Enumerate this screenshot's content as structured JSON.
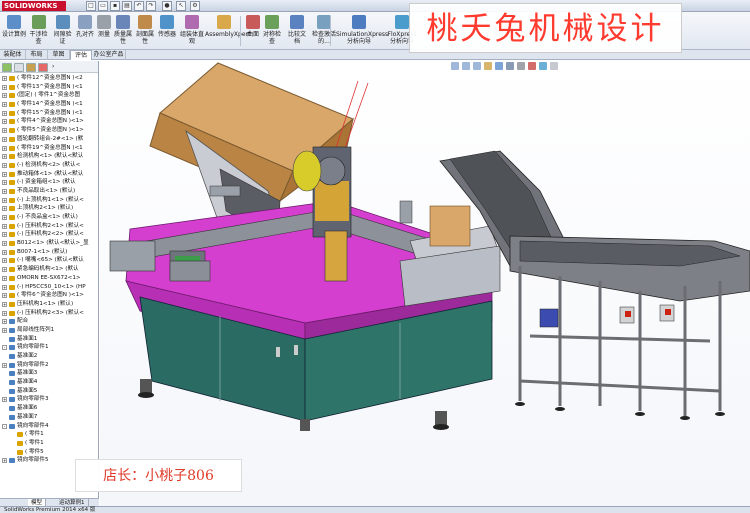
{
  "app": {
    "logo_text": "SOLIDWORKS",
    "status_text": "SolidWorks Premium 2014 x64 版"
  },
  "ribbon": [
    {
      "label": "设计算例",
      "icon": "design-study-icon"
    },
    {
      "label": "干涉检查",
      "icon": "interference-icon"
    },
    {
      "label": "间隙验证",
      "icon": "clearance-icon"
    },
    {
      "label": "孔对齐",
      "icon": "hole-align-icon"
    },
    {
      "label": "测量",
      "icon": "measure-icon"
    },
    {
      "label": "质量属性",
      "icon": "mass-properties-icon"
    },
    {
      "label": "剖面属性",
      "icon": "section-properties-icon"
    },
    {
      "label": "传感器",
      "icon": "sensor-icon"
    },
    {
      "label": "组装体直观",
      "icon": "assembly-visualization-icon"
    },
    {
      "label": "AssemblyXpert",
      "icon": "assemblyxpert-icon"
    },
    {
      "label": "曲面",
      "icon": "surface-icon"
    },
    {
      "label": "对称检查",
      "icon": "symmetry-check-icon"
    },
    {
      "label": "比较文档",
      "icon": "compare-icon"
    },
    {
      "label": "检查激活的...",
      "icon": "check-icon"
    },
    {
      "label": "SimulationXpress 分析向导",
      "icon": "simulationxpress-icon"
    },
    {
      "label": "FloXpress 分析向导",
      "icon": "floxpress-icon"
    }
  ],
  "command_tabs": [
    "装配体",
    "布局",
    "草图",
    "评估",
    "办公室产品"
  ],
  "tree": [
    {
      "label": "( 零件12^资金总图N )<2",
      "exp": "+",
      "color": "#d9a400"
    },
    {
      "label": "( 零件13^资金总图N )<1",
      "exp": "+",
      "color": "#d9a400"
    },
    {
      "label": "(固定) ( 零件1^资金总图",
      "exp": "+",
      "color": "#d9a400"
    },
    {
      "label": "( 零件14^资金总图N )<1",
      "exp": "+",
      "color": "#d9a400"
    },
    {
      "label": "( 零件15^资金总图N )<1",
      "exp": "+",
      "color": "#d9a400"
    },
    {
      "label": "( 零件4^资金总图N )<1>",
      "exp": "+",
      "color": "#d9a400"
    },
    {
      "label": "( 零件5^资金总图N )<1>",
      "exp": "+",
      "color": "#d9a400"
    },
    {
      "label": "圆轮翻转组合-2#<1> (默",
      "exp": "+",
      "color": "#d9a400"
    },
    {
      "label": "( 零件19^资金总图N )<1",
      "exp": "+",
      "color": "#d9a400"
    },
    {
      "label": "检测机构<1> (默认<默认",
      "exp": "+",
      "color": "#d9a400"
    },
    {
      "label": "(-) 检测机构<2> (默认<",
      "exp": "+",
      "color": "#d9a400"
    },
    {
      "label": "推动箱体<1> (默认<默认",
      "exp": "+",
      "color": "#d9a400"
    },
    {
      "label": "(-) 资金箱组<1> (默认",
      "exp": "+",
      "color": "#d9a400"
    },
    {
      "label": "不良品取出<1> (默认)",
      "exp": "+",
      "color": "#d9a400"
    },
    {
      "label": "(-) 上顶机构1<1> (默认<",
      "exp": "+",
      "color": "#d9a400"
    },
    {
      "label": "上顶机构2<1> (默认)",
      "exp": "+",
      "color": "#d9a400"
    },
    {
      "label": "(-) 不良品盒<1> (默认)",
      "exp": "+",
      "color": "#d9a400"
    },
    {
      "label": "(-) 压料机构2<1> (默认<",
      "exp": "+",
      "color": "#d9a400"
    },
    {
      "label": "(-) 压料机构2<2> (默认<",
      "exp": "+",
      "color": "#d9a400"
    },
    {
      "label": "B012<1> (默认<默认>_显",
      "exp": "+",
      "color": "#d9a400"
    },
    {
      "label": "B007-1<1> (默认)",
      "exp": "+",
      "color": "#d9a400"
    },
    {
      "label": "(-) 嘴嘴<65> (默认<默认",
      "exp": "+",
      "color": "#d9a400"
    },
    {
      "label": "紧急编码机构<1> (默认",
      "exp": "+",
      "color": "#d9a400"
    },
    {
      "label": "OMORN EE-SX672<1>",
      "exp": "+",
      "color": "#d9a400"
    },
    {
      "label": "(-) HP5CC50_10<1> (HP",
      "exp": "+",
      "color": "#d9a400"
    },
    {
      "label": "( 零件6^资金总图N )<1>",
      "exp": "+",
      "color": "#d9a400"
    },
    {
      "label": "压料机构1<1> (默认)",
      "exp": "+",
      "color": "#d9a400"
    },
    {
      "label": "(-) 压料机构2<3> (默认<",
      "exp": "+",
      "color": "#d9a400"
    },
    {
      "label": "配合",
      "exp": "+",
      "color": "#4a7fc0"
    },
    {
      "label": "局部线性阵列1",
      "exp": "+",
      "color": "#4a7fc0"
    },
    {
      "label": "基准面1",
      "exp": "",
      "color": "#4a7fc0"
    },
    {
      "label": "镜向零部件1",
      "exp": "-",
      "color": "#4a7fc0"
    },
    {
      "label": "基准面2",
      "exp": "",
      "color": "#4a7fc0"
    },
    {
      "label": "镜向零部件2",
      "exp": "+",
      "color": "#4a7fc0"
    },
    {
      "label": "基准面3",
      "exp": "",
      "color": "#4a7fc0"
    },
    {
      "label": "基准面4",
      "exp": "",
      "color": "#4a7fc0"
    },
    {
      "label": "基准面5",
      "exp": "",
      "color": "#4a7fc0"
    },
    {
      "label": "镜向零部件3",
      "exp": "+",
      "color": "#4a7fc0"
    },
    {
      "label": "基准面6",
      "exp": "",
      "color": "#4a7fc0"
    },
    {
      "label": "基准面7",
      "exp": "",
      "color": "#4a7fc0"
    },
    {
      "label": "镜向零部件4",
      "exp": "-",
      "color": "#4a7fc0"
    },
    {
      "label": "( 零件1",
      "exp": "",
      "color": "#d9a400"
    },
    {
      "label": "( 零件1",
      "exp": "",
      "color": "#d9a400"
    },
    {
      "label": "( 零件5",
      "exp": "",
      "color": "#d9a400"
    },
    {
      "label": "镜向零部件5",
      "exp": "+",
      "color": "#4a7fc0"
    }
  ],
  "bottom_tabs": [
    "模型",
    "运动算例1"
  ],
  "overlays": {
    "brand_text": "桃夭兔机械设计",
    "seller_text": "店长：小桃子806"
  },
  "colors": {
    "machine_magenta": "#d43fd0",
    "cabinet_teal": "#2a6b63",
    "conveyor_gray": "#7d8086",
    "box_tan": "#c99757",
    "watermark_red": "#ff3a2e"
  }
}
